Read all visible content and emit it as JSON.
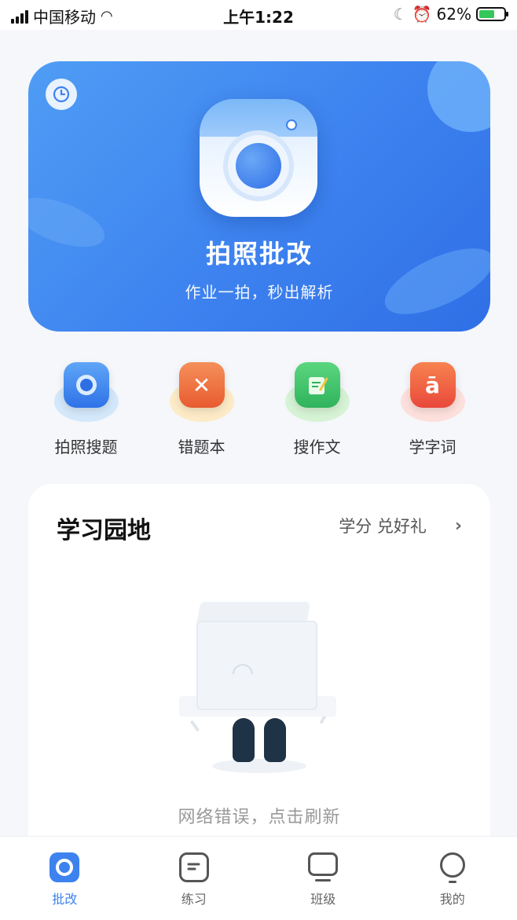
{
  "status_bar": {
    "carrier": "中国移动",
    "time": "上午1:22",
    "battery": "62%",
    "battery_level": 0.62
  },
  "hero": {
    "title": "拍照批改",
    "subtitle": "作业一拍，秒出解析",
    "icons": [
      "clock-icon",
      "camera-icon"
    ]
  },
  "features": [
    {
      "label": "拍照搜题",
      "icon": "camera-icon",
      "color": "#3b86f2"
    },
    {
      "label": "错题本",
      "icon": "wrong-book-icon",
      "color": "#f06a3b"
    },
    {
      "label": "搜作文",
      "icon": "essay-icon",
      "color": "#3cc46c"
    },
    {
      "label": "学字词",
      "icon": "word-icon",
      "color": "#f05a4a"
    }
  ],
  "study_card": {
    "title": "学习园地",
    "link": "学分 兑好礼",
    "empty_text": "网络错误，点击刷新"
  },
  "tabbar": [
    {
      "label": "批改",
      "active": true
    },
    {
      "label": "练习",
      "active": false
    },
    {
      "label": "班级",
      "active": false
    },
    {
      "label": "我的",
      "active": false
    }
  ],
  "colors": {
    "accent": "#3d82ef",
    "background": "#f5f7fb"
  }
}
